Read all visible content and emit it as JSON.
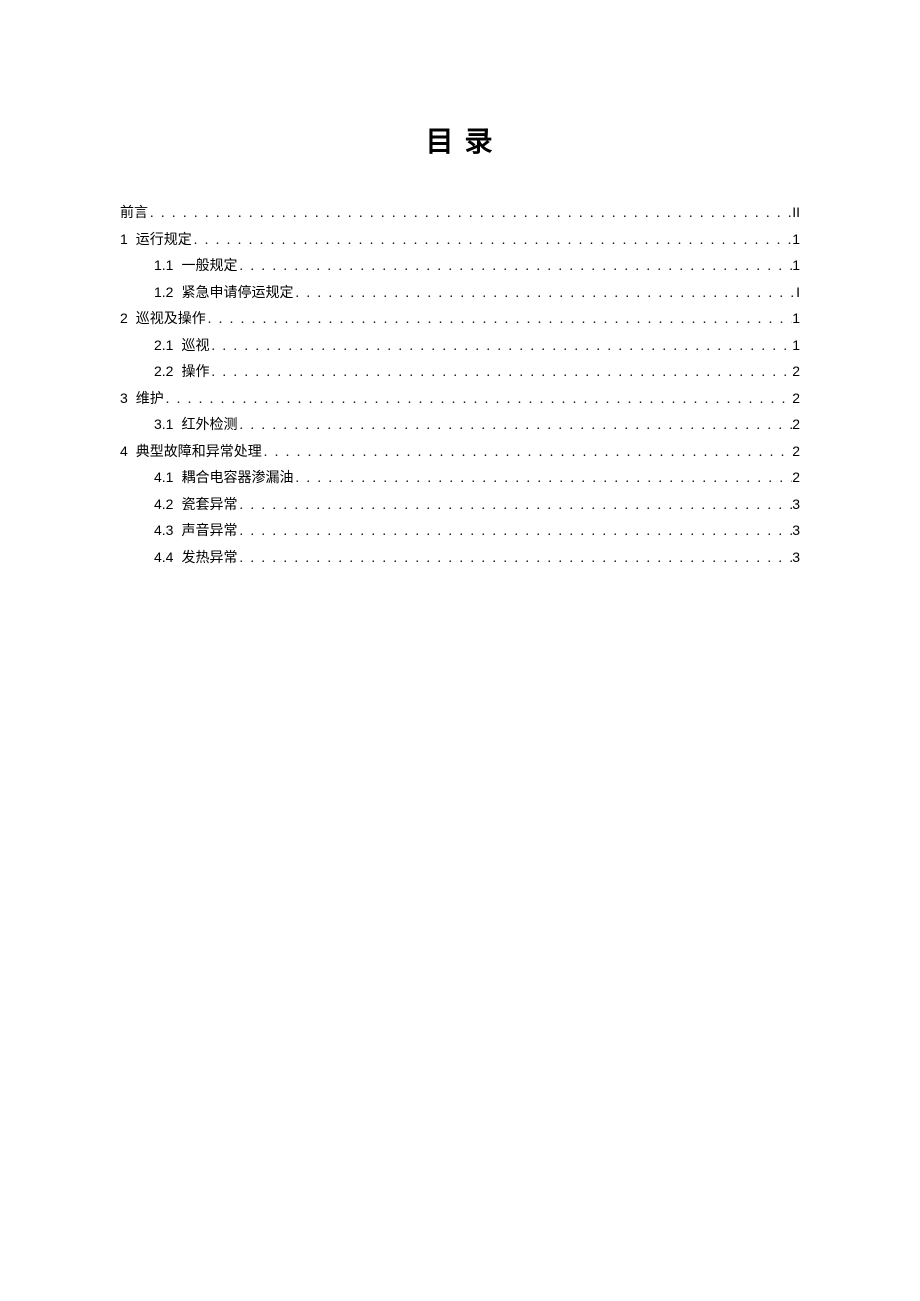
{
  "title": "目 录",
  "toc": [
    {
      "level": 0,
      "num": "",
      "label": "前言",
      "page": "II"
    },
    {
      "level": 0,
      "num": "1",
      "label": "运行规定",
      "page": "1"
    },
    {
      "level": 1,
      "num": "1.1",
      "label": "一般规定",
      "page": "1"
    },
    {
      "level": 1,
      "num": "1.2",
      "label": "紧急申请停运规定",
      "page": "I"
    },
    {
      "level": 0,
      "num": "2",
      "label": "巡视及操作",
      "page": "1"
    },
    {
      "level": 1,
      "num": "2.1",
      "label": "巡视",
      "page": "1"
    },
    {
      "level": 1,
      "num": "2.2",
      "label": "操作",
      "page": "2"
    },
    {
      "level": 0,
      "num": "3",
      "label": "维护",
      "page": "2"
    },
    {
      "level": 1,
      "num": "3.1",
      "label": "红外检测",
      "page": "2"
    },
    {
      "level": 0,
      "num": "4",
      "label": "典型故障和异常处理",
      "page": "2"
    },
    {
      "level": 1,
      "num": "4.1",
      "label": "耦合电容器渗漏油",
      "page": "2"
    },
    {
      "level": 1,
      "num": "4.2",
      "label": "瓷套异常",
      "page": "3"
    },
    {
      "level": 1,
      "num": "4.3",
      "label": "声音异常",
      "page": "3"
    },
    {
      "level": 1,
      "num": "4.4",
      "label": "发热异常",
      "page": "3"
    }
  ]
}
